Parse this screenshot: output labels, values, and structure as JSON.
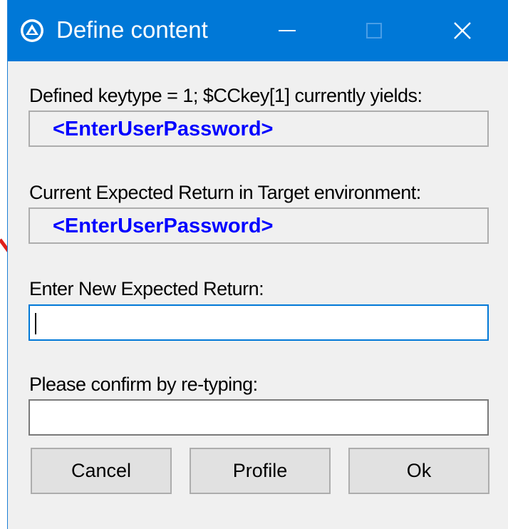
{
  "window": {
    "title": "Define content"
  },
  "fields": {
    "keytype_label": "Defined keytype = 1;  $CCkey[1] currently yields:",
    "keytype_value": "<EnterUserPassword>",
    "current_return_label": "Current Expected Return in Target environment:",
    "current_return_value": "<EnterUserPassword>",
    "new_return_label": "Enter New Expected Return:",
    "new_return_value": "",
    "confirm_label": "Please confirm by re-typing:",
    "confirm_value": ""
  },
  "buttons": {
    "cancel": "Cancel",
    "profile": "Profile",
    "ok": "Ok"
  },
  "colors": {
    "titlebar": "#0078d7",
    "value_text": "#0000ff",
    "annotation_arrow": "#e0201b"
  }
}
